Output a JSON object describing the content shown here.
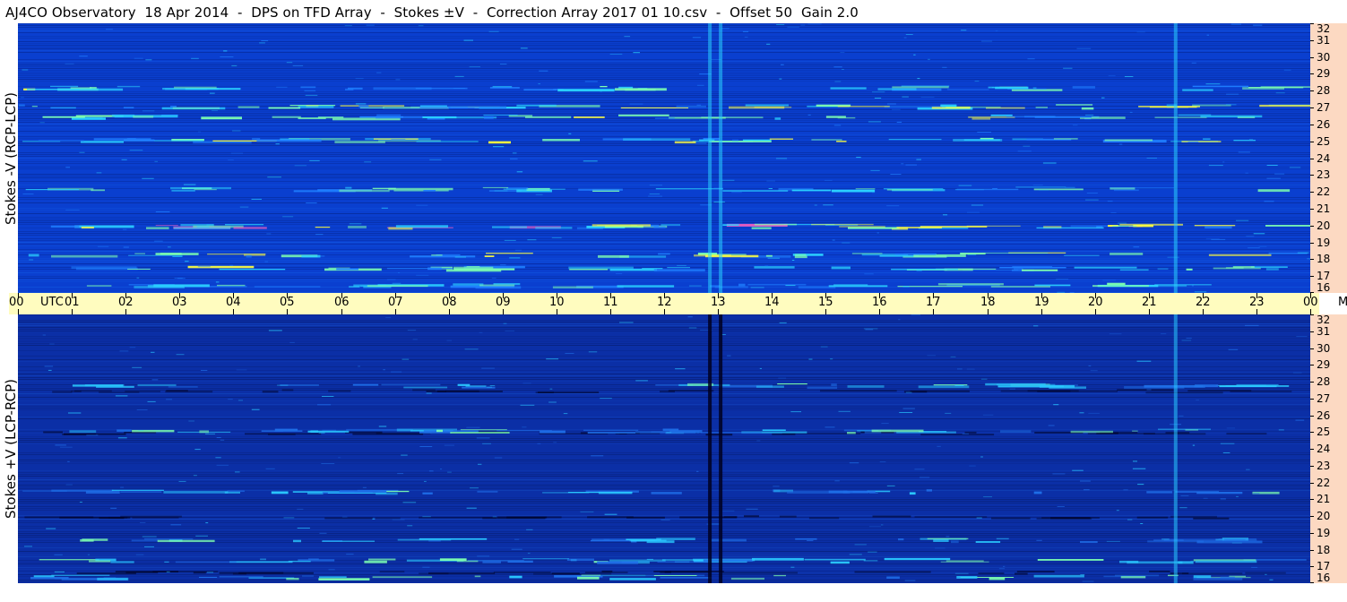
{
  "title": "AJ4CO Observatory  18 Apr 2014  -  DPS on TFD Array  -  Stokes ±V  -  Correction Array 2017 01 10.csv  -  Offset 50  Gain 2.0",
  "chart_data": [
    {
      "type": "heatmap",
      "panel": "top",
      "ylabel": "Stokes -V (RCP-LCP)",
      "x_range_utc_hours": [
        0,
        24
      ],
      "y_range_mhz": [
        16,
        32
      ],
      "y_ticks": [
        "32",
        "31",
        "30",
        "29",
        "28",
        "27",
        "26",
        "25",
        "24",
        "23",
        "22",
        "21",
        "20",
        "19",
        "18",
        "17",
        "16"
      ],
      "background_color": "#0a3fcf",
      "colormap": [
        "#000030",
        "#0a3fcf",
        "#1f7fff",
        "#2ad0ff",
        "#7dffb0",
        "#ffff40",
        "#ff60c0"
      ],
      "bright_bands_mhz": [
        {
          "mhz": 28.2,
          "intensity": 0.6
        },
        {
          "mhz": 27.1,
          "intensity": 0.75
        },
        {
          "mhz": 26.5,
          "intensity": 0.6
        },
        {
          "mhz": 25.1,
          "intensity": 0.65
        },
        {
          "mhz": 22.2,
          "intensity": 0.5
        },
        {
          "mhz": 20.0,
          "intensity": 0.9
        },
        {
          "mhz": 18.3,
          "intensity": 0.6
        },
        {
          "mhz": 17.5,
          "intensity": 0.55
        },
        {
          "mhz": 16.5,
          "intensity": 0.5
        }
      ],
      "vertical_features_utc": [
        {
          "utc": 12.85,
          "kind": "bright"
        },
        {
          "utc": 13.05,
          "kind": "bright"
        },
        {
          "utc": 21.5,
          "kind": "bright"
        }
      ]
    },
    {
      "type": "heatmap",
      "panel": "bottom",
      "ylabel": "Stokes +V (LCP-RCP)",
      "x_range_utc_hours": [
        0,
        24
      ],
      "y_range_mhz": [
        16,
        32
      ],
      "y_ticks": [
        "32",
        "31",
        "30",
        "29",
        "28",
        "27",
        "26",
        "25",
        "24",
        "23",
        "22",
        "21",
        "20",
        "19",
        "18",
        "17",
        "16"
      ],
      "background_color": "#0b2fa6",
      "colormap": [
        "#000020",
        "#0b2fa6",
        "#1f6fe8",
        "#2ac8ff",
        "#7dffb0",
        "#ffff40"
      ],
      "bright_bands_mhz": [
        {
          "mhz": 27.8,
          "intensity": 0.5
        },
        {
          "mhz": 25.1,
          "intensity": 0.55
        },
        {
          "mhz": 21.5,
          "intensity": 0.45
        },
        {
          "mhz": 18.6,
          "intensity": 0.5
        },
        {
          "mhz": 17.4,
          "intensity": 0.6
        },
        {
          "mhz": 16.4,
          "intensity": 0.55
        }
      ],
      "dark_bands_mhz": [
        {
          "mhz": 27.5,
          "intensity": 0.6
        },
        {
          "mhz": 25.0,
          "intensity": 0.7
        },
        {
          "mhz": 20.0,
          "intensity": 0.6
        },
        {
          "mhz": 16.7,
          "intensity": 0.6
        }
      ],
      "vertical_features_utc": [
        {
          "utc": 12.85,
          "kind": "dark"
        },
        {
          "utc": 13.05,
          "kind": "dark"
        },
        {
          "utc": 21.5,
          "kind": "bright"
        }
      ]
    }
  ],
  "time_axis": {
    "labels": [
      "00",
      "UTC",
      "01",
      "02",
      "03",
      "04",
      "05",
      "06",
      "07",
      "08",
      "09",
      "10",
      "11",
      "12",
      "13",
      "14",
      "15",
      "16",
      "17",
      "18",
      "19",
      "20",
      "21",
      "22",
      "23",
      "00",
      "MHz"
    ],
    "hours": [
      0,
      0.45,
      1,
      2,
      3,
      4,
      5,
      6,
      7,
      8,
      9,
      10,
      11,
      12,
      13,
      14,
      15,
      16,
      17,
      18,
      19,
      20,
      21,
      22,
      23,
      24,
      24.55
    ],
    "background_color": "#fffcbf"
  },
  "freq_axis_background": "#fcd9c2"
}
